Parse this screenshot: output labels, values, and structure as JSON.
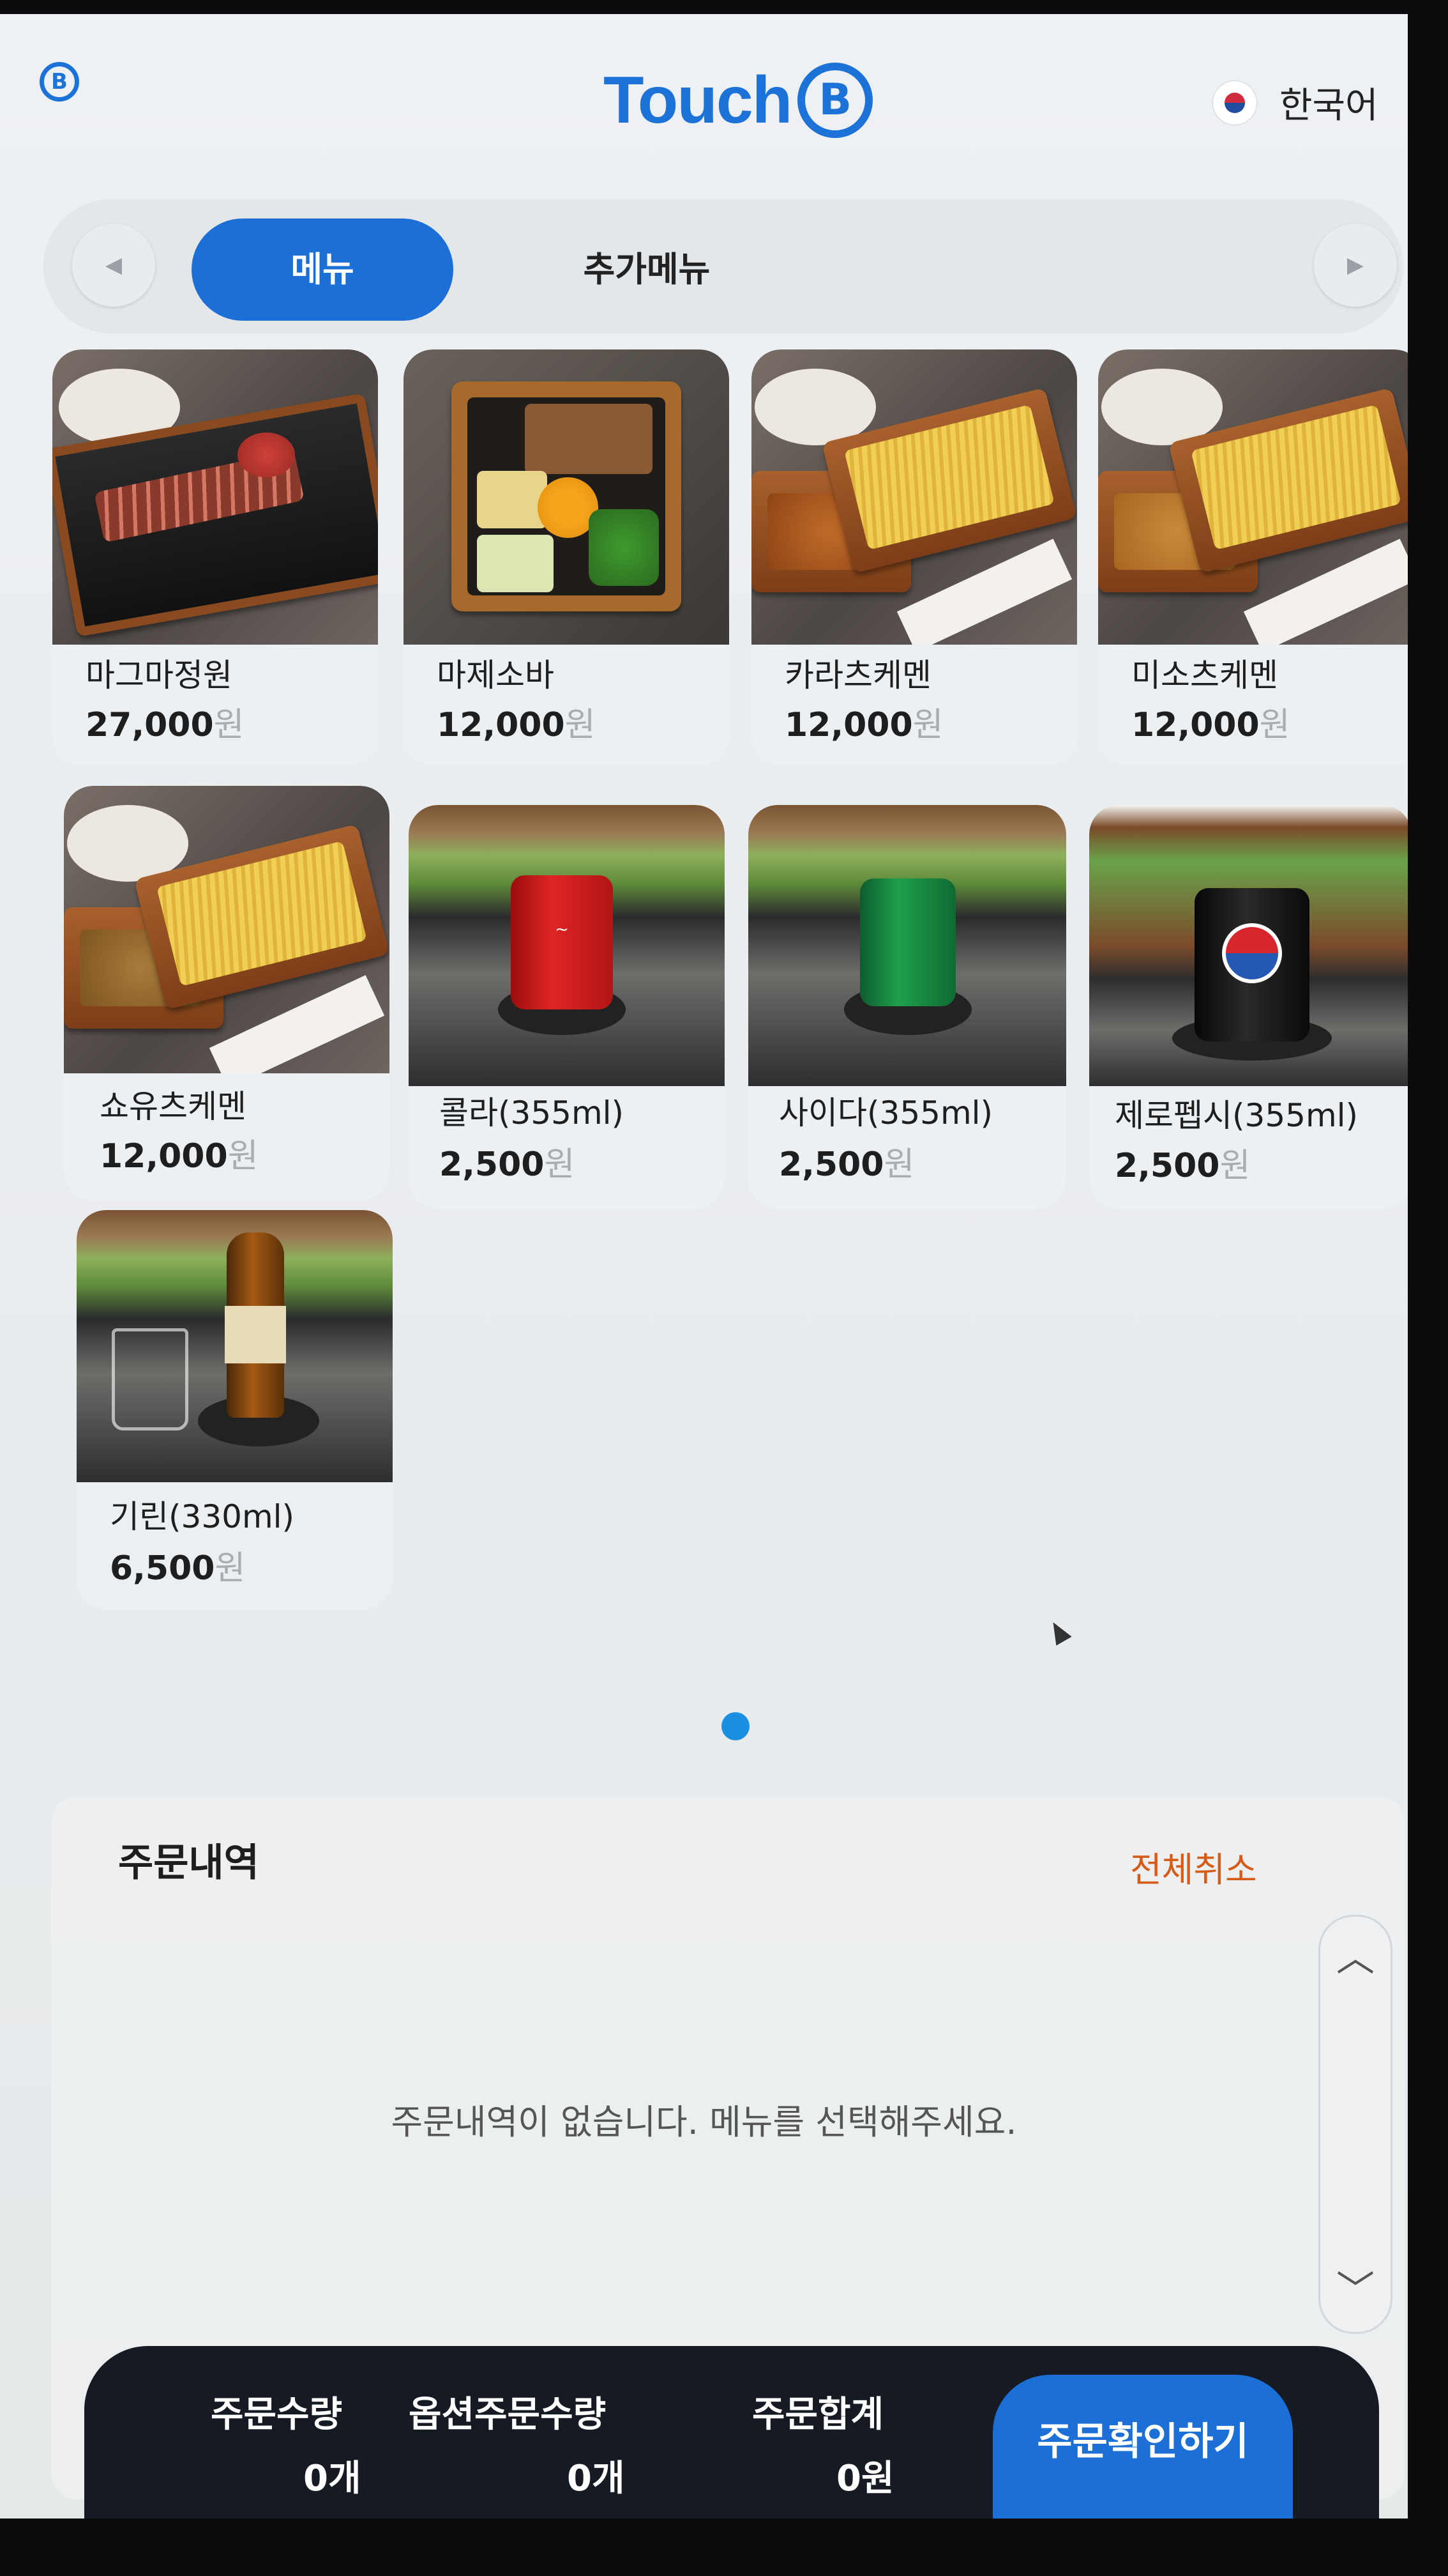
{
  "header": {
    "small_logo": "B",
    "brand": "Touch",
    "brand_mark": "B",
    "language": "한국어",
    "flag_icon": "korea-flag-icon"
  },
  "tabs": {
    "prev": "◀",
    "next": "▶",
    "items": [
      {
        "label": "메뉴",
        "active": true
      },
      {
        "label": "추가메뉴",
        "active": false
      }
    ]
  },
  "menu": [
    {
      "name": "마그마정원",
      "price": "27,000",
      "won": "원"
    },
    {
      "name": "마제소바",
      "price": "12,000",
      "won": "원"
    },
    {
      "name": "카라츠케멘",
      "price": "12,000",
      "won": "원"
    },
    {
      "name": "미소츠케멘",
      "price": "12,000",
      "won": "원"
    },
    {
      "name": "쇼유츠케멘",
      "price": "12,000",
      "won": "원"
    },
    {
      "name": "콜라(355ml)",
      "price": "2,500",
      "won": "원"
    },
    {
      "name": "사이다(355ml)",
      "price": "2,500",
      "won": "원"
    },
    {
      "name": "제로펩시(355ml)",
      "price": "2,500",
      "won": "원"
    },
    {
      "name": "기린(330ml)",
      "price": "6,500",
      "won": "원"
    }
  ],
  "order": {
    "title": "주문내역",
    "clear_all": "전체취소",
    "empty_message": "주문내역이 없습니다. 메뉴를 선택해주세요.",
    "scroll_up": "︿",
    "scroll_down": "﹀"
  },
  "summary": {
    "quantity_label": "주문수량",
    "quantity_value": "0개",
    "option_label": "옵션주문수량",
    "option_value": "0개",
    "total_label": "주문합계",
    "total_value": "0원",
    "confirm": "주문확인하기"
  },
  "colors": {
    "accent": "#1b6fd6",
    "clear_all": "#d55b17",
    "bottom_bar": "#161a23",
    "page_dot": "#1a8ee0"
  }
}
